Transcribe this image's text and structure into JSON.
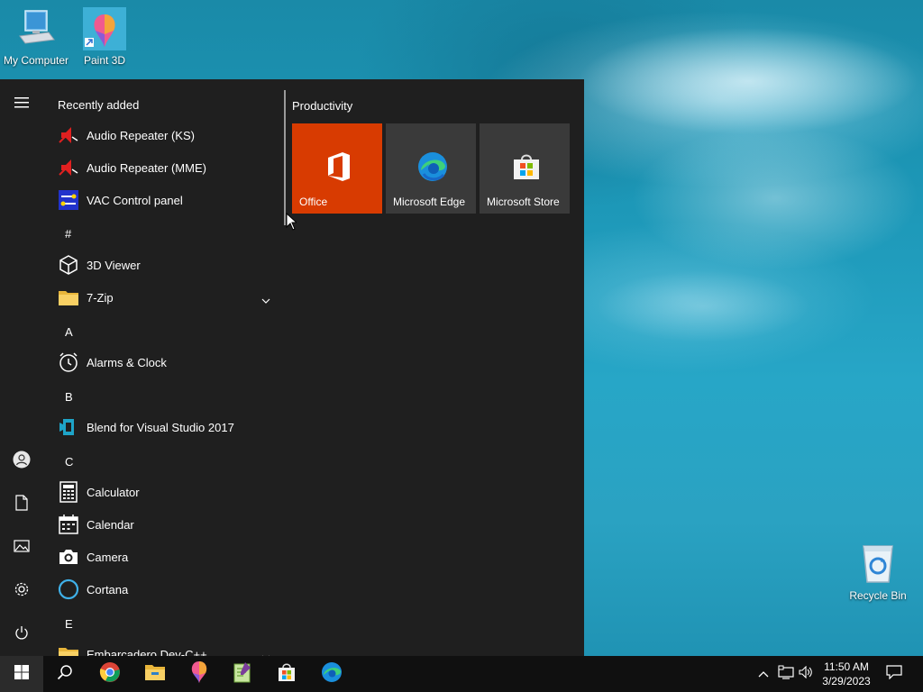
{
  "desktop": {
    "icons": [
      {
        "label": "My Computer",
        "icon": "computer-icon"
      },
      {
        "label": "Paint 3D",
        "icon": "paint-3d-icon"
      },
      {
        "label": "Recycle Bin",
        "icon": "recycle-bin-icon"
      }
    ]
  },
  "start_menu": {
    "recently_added_label": "Recently added",
    "recent_apps": [
      {
        "label": "Audio Repeater (KS)",
        "icon": "audio-repeater-icon"
      },
      {
        "label": "Audio Repeater (MME)",
        "icon": "audio-repeater-icon"
      },
      {
        "label": "VAC Control panel",
        "icon": "vac-control-icon"
      }
    ],
    "groups": [
      {
        "letter": "#",
        "apps": [
          {
            "label": "3D Viewer",
            "icon": "3d-viewer-icon"
          },
          {
            "label": "7-Zip",
            "icon": "folder-icon",
            "expandable": true
          }
        ]
      },
      {
        "letter": "A",
        "apps": [
          {
            "label": "Alarms & Clock",
            "icon": "alarm-clock-icon"
          }
        ]
      },
      {
        "letter": "B",
        "apps": [
          {
            "label": "Blend for Visual Studio 2017",
            "icon": "blend-icon"
          }
        ]
      },
      {
        "letter": "C",
        "apps": [
          {
            "label": "Calculator",
            "icon": "calculator-icon"
          },
          {
            "label": "Calendar",
            "icon": "calendar-icon"
          },
          {
            "label": "Camera",
            "icon": "camera-icon"
          },
          {
            "label": "Cortana",
            "icon": "cortana-icon"
          }
        ]
      },
      {
        "letter": "E",
        "apps": [
          {
            "label": "Embarcadero Dev-C++",
            "icon": "folder-icon",
            "expandable": true
          }
        ]
      }
    ],
    "rail_icons": [
      "hamburger-icon",
      "user-icon",
      "documents-icon",
      "pictures-icon",
      "settings-icon",
      "power-icon"
    ],
    "tiles_group_title": "Productivity",
    "tiles": [
      {
        "label": "Office",
        "icon": "office-icon",
        "color": "#d83b01"
      },
      {
        "label": "Microsoft Edge",
        "icon": "edge-icon",
        "color": "#3a3a3a"
      },
      {
        "label": "Microsoft Store",
        "icon": "store-icon",
        "color": "#3a3a3a"
      }
    ]
  },
  "taskbar": {
    "pinned": [
      "start-icon",
      "search-icon",
      "chrome-icon",
      "file-explorer-icon",
      "paint-3d-icon",
      "notepad-plus-plus-icon",
      "store-icon",
      "edge-icon"
    ],
    "tray": [
      "chevron-up-icon",
      "network-icon",
      "volume-icon",
      "notification-icon"
    ],
    "time": "11:50 AM",
    "date": "3/29/2023"
  }
}
